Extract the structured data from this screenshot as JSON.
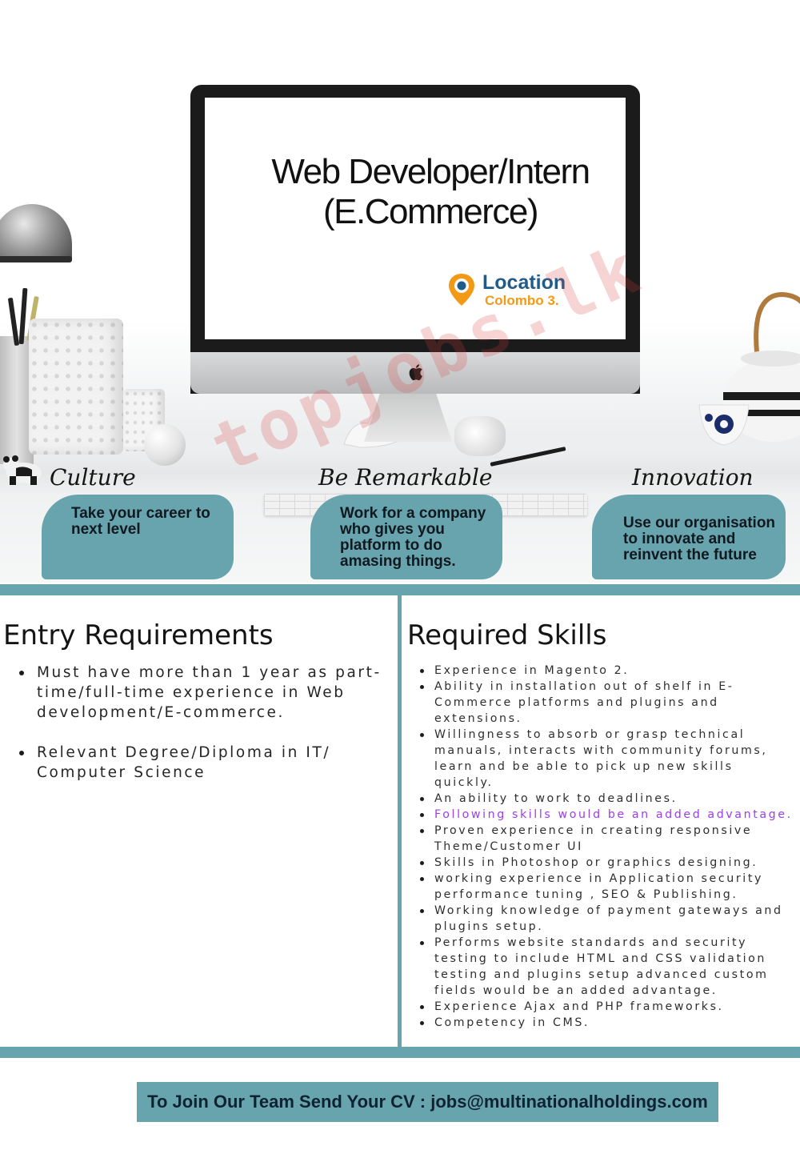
{
  "hero": {
    "job_title_line1": "Web Developer/Intern",
    "job_title_line2": "(E.Commerce)",
    "location_label": "Location",
    "location_value": "Colombo 3.",
    "watermark": "topjobs.lk"
  },
  "pillars": [
    {
      "title": "Culture",
      "text": "Take your career to next level"
    },
    {
      "title": "Be Remarkable",
      "text": "Work for a company who gives you platform to do amasing things."
    },
    {
      "title": "Innovation",
      "text": "Use our organisation to innovate and reinvent the future"
    }
  ],
  "entry_requirements": {
    "heading": "Entry Requirements",
    "items": [
      "Must have more than 1 year as part-time/full-time experience in Web development/E-commerce.",
      "Relevant Degree/Diploma in IT/ Computer Science"
    ]
  },
  "required_skills": {
    "heading": "Required Skills",
    "items": [
      "Experience in Magento 2.",
      "Ability in installation out of shelf in E-Commerce platforms and plugins and extensions.",
      "Willingness to absorb or grasp technical manuals, interacts with community forums, learn and be able to pick up new skills quickly.",
      "An ability to work to deadlines.",
      "Following skills would be an added advantage.",
      "Proven experience in creating responsive Theme/Customer UI",
      "Skills in Photoshop or graphics designing.",
      "working experience in Application security performance tuning , SEO & Publishing.",
      "Working knowledge of payment gateways and plugins setup.",
      "Performs website standards and security testing to include HTML and CSS validation testing and plugins setup advanced custom fields would be an added advantage.",
      "Experience Ajax and PHP frameworks.",
      "Competency in CMS."
    ]
  },
  "cta": {
    "text": "To Join Our Team Send Your CV : jobs@multinationalholdings.com"
  },
  "colors": {
    "teal": "#68a4ad",
    "location_blue": "#1f5c8c",
    "location_orange": "#f29a16",
    "accent_purple": "#9b3ee6"
  }
}
